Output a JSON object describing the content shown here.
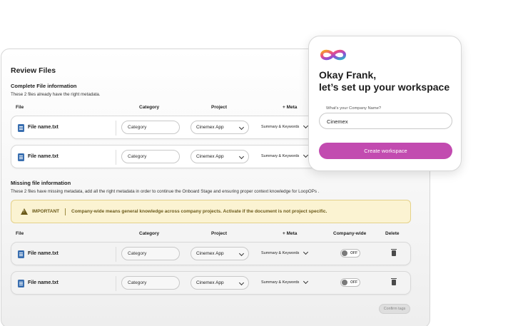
{
  "review": {
    "title": "Review Files",
    "complete": {
      "title": "Complete File information",
      "description": "These 2 files already have the right metadata.",
      "columns": {
        "file": "File",
        "category": "Category",
        "project": "Project",
        "meta": "+ Meta"
      },
      "rows": [
        {
          "file": "File name.txt",
          "category": "Category",
          "project": "Cinemex App",
          "meta": "Summary & Keywords"
        },
        {
          "file": "File name.txt",
          "category": "Category",
          "project": "Cinemex App",
          "meta": "Summary & Keywords"
        }
      ]
    },
    "missing": {
      "title": "Missing file information",
      "description": "These 2 files have missing metadata, add all the right metadata in order to continue the Onboard Stage and ensuring proper context knowledge for LoopOPs .",
      "important_label": "IMPORTANT",
      "important_text": "Company-wide means general knowledge across company projects. Activate if the document is not project specific.",
      "columns": {
        "file": "File",
        "category": "Category",
        "project": "Project",
        "meta": "+ Meta",
        "company_wide": "Company-wide",
        "delete": "Delete"
      },
      "rows": [
        {
          "file": "File name.txt",
          "category": "Category",
          "project": "Cinemex App",
          "meta": "Summary & Keywords",
          "toggle": "OFF"
        },
        {
          "file": "File name.txt",
          "category": "Category",
          "project": "Cinemex App",
          "meta": "Summary & Keywords",
          "toggle": "OFF"
        }
      ]
    },
    "confirm_label": "Confirm tags"
  },
  "workspace": {
    "title_line1": "Okay Frank,",
    "title_line2": "let’s set up your workspace",
    "company_label": "What's your Company Name?",
    "company_value": "Cinemex",
    "button_label": "Create workspace"
  },
  "colors": {
    "accent": "#c24bb0",
    "warning_bg": "#fbf3d2",
    "warning_text": "#6b5a1a",
    "file_icon": "#3a6fb0"
  }
}
